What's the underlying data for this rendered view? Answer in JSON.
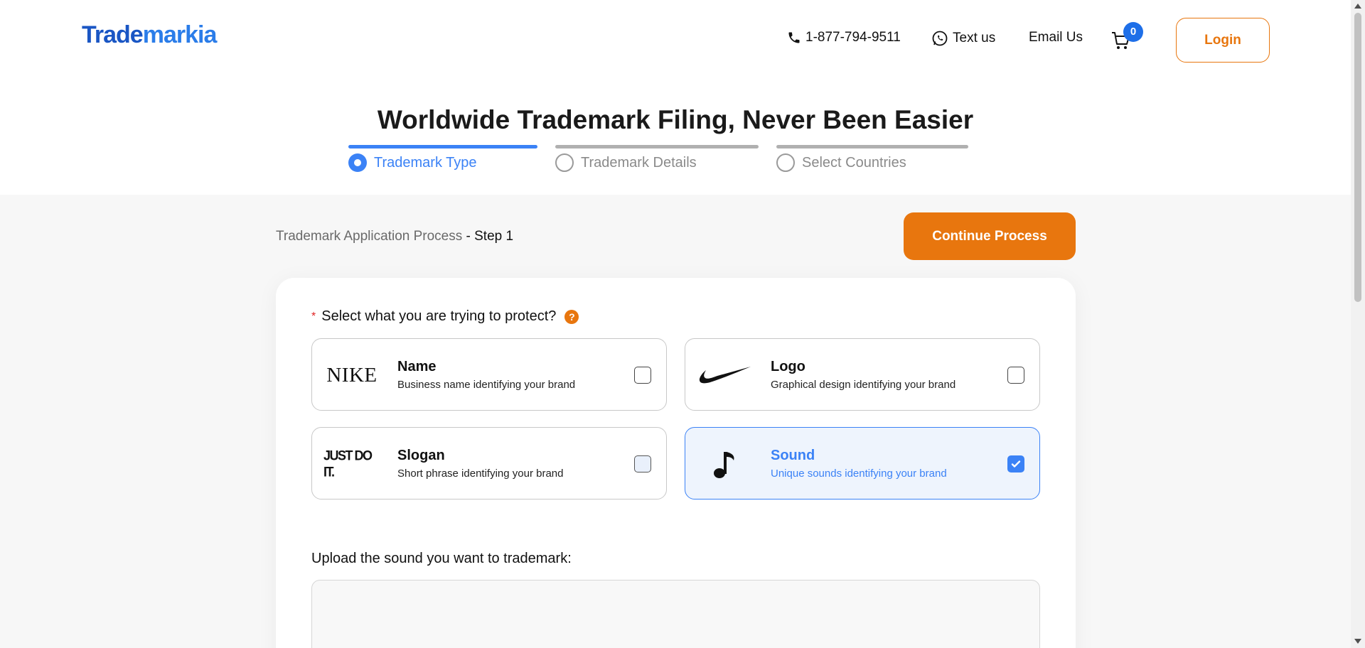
{
  "header": {
    "logo_part1": "Trade",
    "logo_part2": "markia",
    "phone": "1-877-794-9511",
    "text_us": "Text us",
    "email_us": "Email Us",
    "cart_count": "0",
    "login_label": "Login"
  },
  "hero": {
    "title": "Worldwide Trademark Filing, Never Been Easier",
    "steps": [
      {
        "label": "Trademark Type",
        "active": true
      },
      {
        "label": "Trademark Details",
        "active": false
      },
      {
        "label": "Select Countries",
        "active": false
      }
    ]
  },
  "process": {
    "breadcrumb": "Trademark Application Process",
    "step_label": "- Step 1",
    "continue_label": "Continue Process"
  },
  "form": {
    "required_mark": "*",
    "question": "Select what you are trying to protect?",
    "help_glyph": "?",
    "options": [
      {
        "thumb": "NIKE",
        "title": "Name",
        "desc": "Business name identifying your brand",
        "checked": false
      },
      {
        "thumb": "nike-swoosh-logo",
        "title": "Logo",
        "desc": "Graphical design identifying your brand",
        "checked": false
      },
      {
        "thumb": "JUST DO IT.",
        "title": "Slogan",
        "desc": "Short phrase identifying your brand",
        "checked": false
      },
      {
        "thumb": "music-note-icon",
        "title": "Sound",
        "desc": "Unique sounds identifying your brand",
        "checked": true
      }
    ],
    "upload_label": "Upload the sound you want to trademark:"
  },
  "colors": {
    "brand_blue": "#1a56c4",
    "accent_orange": "#e8760e",
    "select_blue": "#3b82f6"
  }
}
